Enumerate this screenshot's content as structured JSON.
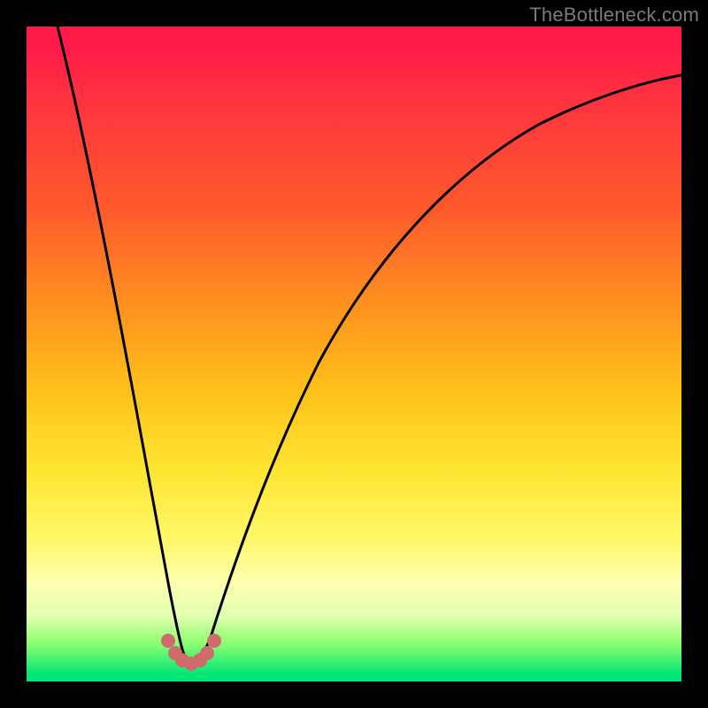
{
  "watermark": "TheBottleneck.com",
  "chart_data": {
    "type": "line",
    "title": "",
    "xlabel": "",
    "ylabel": "",
    "xlim": [
      0,
      100
    ],
    "ylim": [
      0,
      100
    ],
    "gradient_stops": [
      {
        "pos": 0,
        "color": "#ff1a4a"
      },
      {
        "pos": 28,
        "color": "#ff5a2c"
      },
      {
        "pos": 56,
        "color": "#ffc21a"
      },
      {
        "pos": 78,
        "color": "#fff766"
      },
      {
        "pos": 94,
        "color": "#90ff70"
      },
      {
        "pos": 100,
        "color": "#00e676"
      }
    ],
    "series": [
      {
        "name": "bottleneck-curve",
        "x": [
          0,
          4,
          8,
          12,
          16,
          19,
          21,
          23,
          25,
          27,
          30,
          34,
          40,
          48,
          56,
          64,
          72,
          80,
          88,
          96,
          100
        ],
        "y": [
          100,
          78,
          58,
          40,
          24,
          12,
          6,
          3,
          3,
          6,
          14,
          26,
          42,
          56,
          66,
          74,
          80,
          84,
          87,
          89,
          90
        ]
      }
    ],
    "markers": {
      "name": "highlight-dots",
      "color": "#d06a6a",
      "x": [
        19.5,
        20.8,
        22.0,
        23.5,
        25.0,
        26.3,
        27.5
      ],
      "y": [
        7.0,
        4.5,
        3.0,
        2.5,
        3.0,
        4.5,
        7.0
      ]
    },
    "optimal_x": 23
  }
}
